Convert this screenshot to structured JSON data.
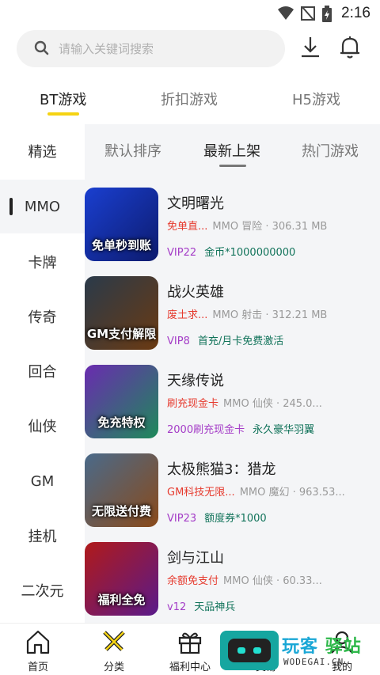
{
  "status_bar": {
    "time": "2:16"
  },
  "search": {
    "placeholder": "请输入关键词搜索"
  },
  "main_tabs": [
    {
      "label": "BT游戏",
      "active": true
    },
    {
      "label": "折扣游戏",
      "active": false
    },
    {
      "label": "H5游戏",
      "active": false
    }
  ],
  "categories": [
    {
      "label": "精选",
      "active": false
    },
    {
      "label": "MMO",
      "active": true
    },
    {
      "label": "卡牌",
      "active": false
    },
    {
      "label": "传奇",
      "active": false
    },
    {
      "label": "回合",
      "active": false
    },
    {
      "label": "仙侠",
      "active": false
    },
    {
      "label": "GM",
      "active": false
    },
    {
      "label": "挂机",
      "active": false
    },
    {
      "label": "二次元",
      "active": false
    }
  ],
  "sort_tabs": [
    {
      "label": "默认排序",
      "active": false
    },
    {
      "label": "最新上架",
      "active": true
    },
    {
      "label": "热门游戏",
      "active": false
    }
  ],
  "games": [
    {
      "name": "文明曙光",
      "tag": "免单直...",
      "info": "MMO 冒险 · 306.31 MB",
      "perk1": "VIP22",
      "perk2": "金币*1000000000",
      "thumb_text": "免单秒到账",
      "thumb_colors": [
        "#1a3fd0",
        "#0d1b6e"
      ]
    },
    {
      "name": "战火英雄",
      "tag": "废土求...",
      "info": "MMO 射击 · 312.21 MB",
      "perk1": "VIP8",
      "perk2": "首充/月卡免费激活",
      "thumb_text": "GM支付解限",
      "thumb_colors": [
        "#2a3a4a",
        "#6b3a12"
      ]
    },
    {
      "name": "天缘传说",
      "tag": "刷充现金卡",
      "info": "MMO 仙侠 · 245.0...",
      "perk1": "2000刷充现金卡",
      "perk2": "永久豪华羽翼",
      "thumb_text": "免充特权",
      "thumb_colors": [
        "#6a2bb0",
        "#1e8a5a"
      ]
    },
    {
      "name": "太极熊猫3：猎龙",
      "tag": "GM科技无限...",
      "info": "MMO 魔幻 · 963.53...",
      "perk1": "VIP23",
      "perk2": "额度券*1000",
      "thumb_text": "无限送付费",
      "thumb_colors": [
        "#4a6a8a",
        "#8a4a1a"
      ]
    },
    {
      "name": "剑与江山",
      "tag": "余额免支付",
      "info": "MMO 仙侠 · 60.33...",
      "perk1": "v12",
      "perk2": "天品神兵",
      "thumb_text": "福利全免",
      "thumb_colors": [
        "#b01a1a",
        "#5a1a8a"
      ]
    }
  ],
  "bottom_nav": [
    {
      "label": "首页",
      "icon": "home-icon"
    },
    {
      "label": "分类",
      "icon": "swords-icon"
    },
    {
      "label": "福利中心",
      "icon": "gift-icon"
    },
    {
      "label": "交易",
      "icon": "trade-icon"
    },
    {
      "label": "我的",
      "icon": "user-icon"
    }
  ],
  "watermark": {
    "brand_1": "玩客",
    "brand_2": "驿站",
    "domain": "WODEGAI.CN"
  }
}
